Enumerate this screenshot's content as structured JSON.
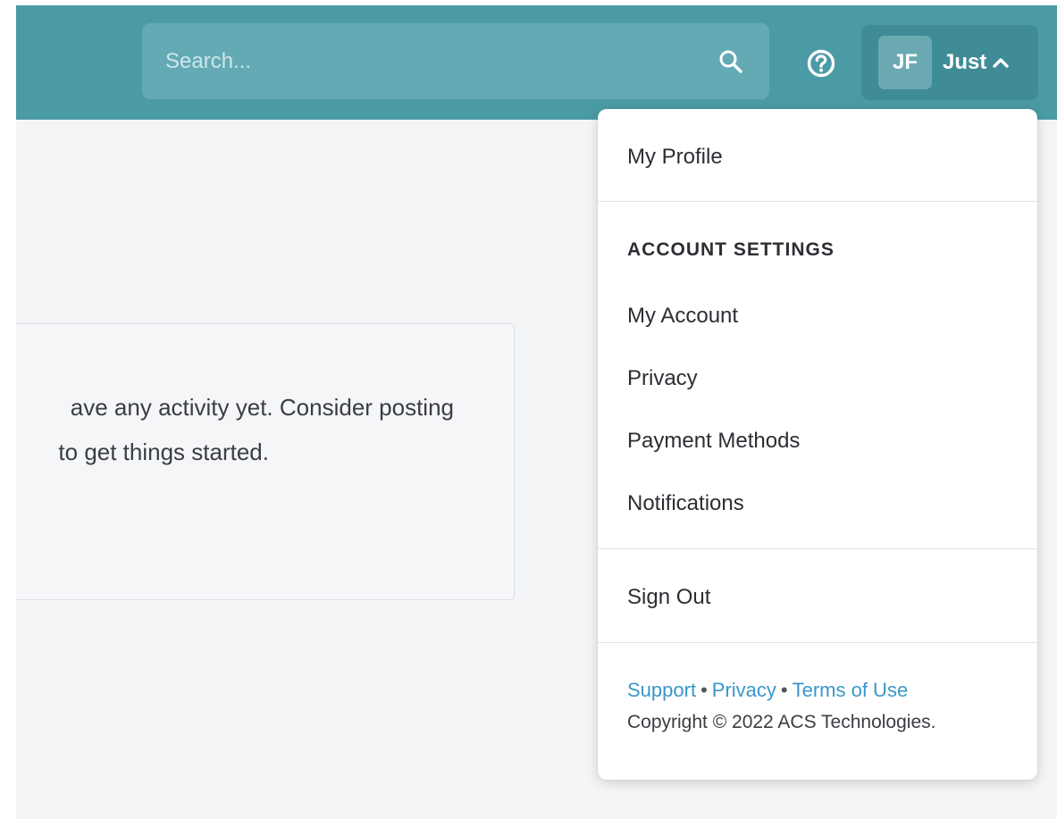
{
  "search": {
    "placeholder": "Search..."
  },
  "user": {
    "initials": "JF",
    "name": "Just"
  },
  "main": {
    "empty_message_line1": "ave any activity yet. Consider posting",
    "empty_message_line2": "to get things started."
  },
  "menu": {
    "profile": "My Profile",
    "account_heading": "ACCOUNT SETTINGS",
    "account": "My Account",
    "privacy": "Privacy",
    "payment": "Payment Methods",
    "notifications": "Notifications",
    "signout": "Sign Out"
  },
  "footer": {
    "support": "Support",
    "privacy": "Privacy",
    "terms": "Terms of Use",
    "separator": "•",
    "copyright": "Copyright © 2022 ACS Technologies."
  },
  "colors": {
    "header": "#4b9ba6",
    "link": "#3a97c9"
  },
  "icons": {
    "search": "search-icon",
    "help": "help-circle-icon",
    "chevron": "chevron-up-icon"
  }
}
